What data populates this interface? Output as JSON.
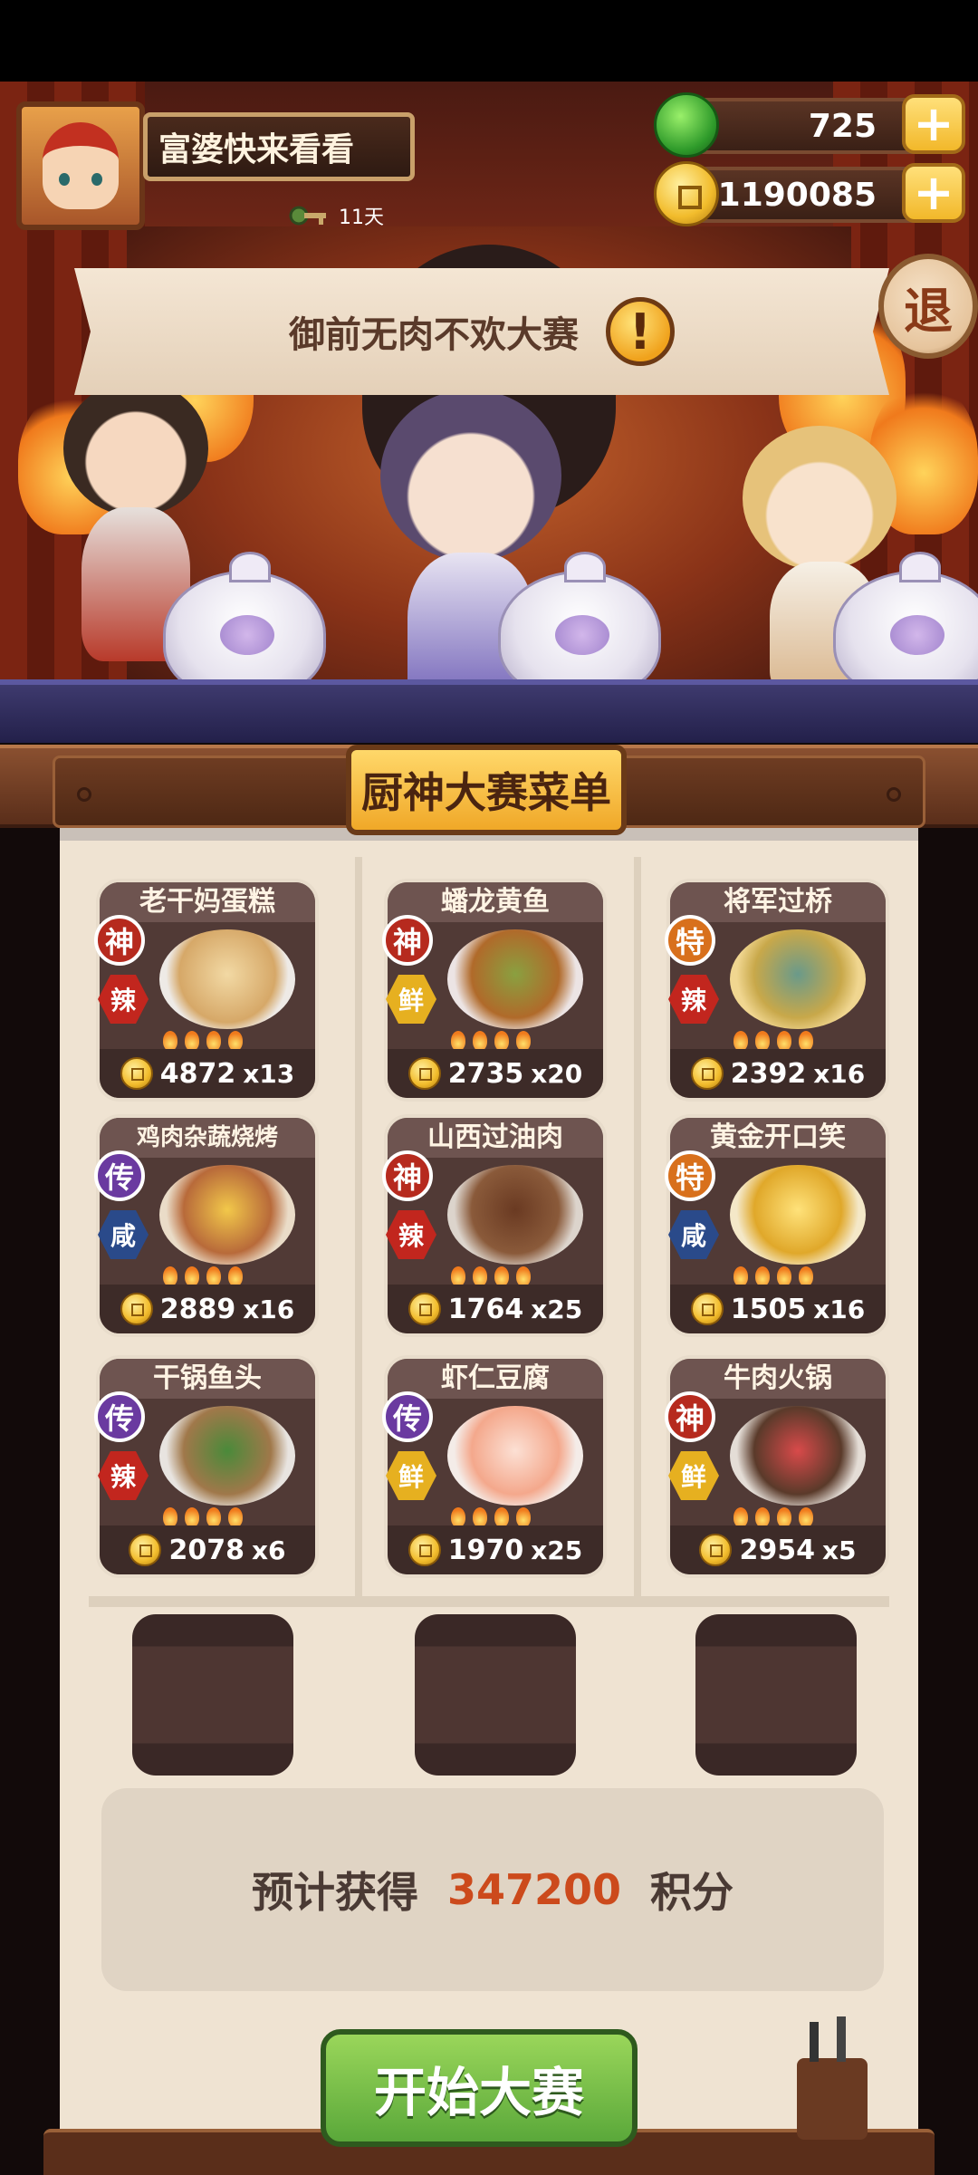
{
  "header": {
    "player_name": "富婆快来看看",
    "days_label": "11天",
    "gems": "725",
    "coins": "1190085",
    "plus_label": "+",
    "exit_label": "退"
  },
  "event": {
    "banner_title": "御前无肉不欢大赛",
    "alert_label": "!"
  },
  "menu": {
    "title": "厨神大赛菜单",
    "dishes": [
      {
        "name": "老干妈蛋糕",
        "rank": "神",
        "taste": "辣",
        "score": "4872",
        "mult": "x13"
      },
      {
        "name": "蟠龙黄鱼",
        "rank": "神",
        "taste": "鲜",
        "score": "2735",
        "mult": "x20"
      },
      {
        "name": "将军过桥",
        "rank": "特",
        "taste": "辣",
        "score": "2392",
        "mult": "x16"
      },
      {
        "name": "鸡肉杂蔬烧烤",
        "rank": "传",
        "taste": "咸",
        "score": "2889",
        "mult": "x16"
      },
      {
        "name": "山西过油肉",
        "rank": "神",
        "taste": "辣",
        "score": "1764",
        "mult": "x25"
      },
      {
        "name": "黄金开口笑",
        "rank": "特",
        "taste": "咸",
        "score": "1505",
        "mult": "x16"
      },
      {
        "name": "干锅鱼头",
        "rank": "传",
        "taste": "辣",
        "score": "2078",
        "mult": "x6"
      },
      {
        "name": "虾仁豆腐",
        "rank": "传",
        "taste": "鲜",
        "score": "1970",
        "mult": "x25"
      },
      {
        "name": "牛肉火锅",
        "rank": "神",
        "taste": "鲜",
        "score": "2954",
        "mult": "x5"
      }
    ]
  },
  "estimate": {
    "prefix": "预计获得",
    "value": "347200",
    "suffix": "积分"
  },
  "start_button": "开始大赛",
  "colors": {
    "rank_shen": "#b62a1e",
    "rank_te": "#d8701c",
    "rank_chuan": "#6a3aa0",
    "taste_la": "#c2261e",
    "taste_xian_fresh": "#e6b020",
    "taste_xian_salty": "#2a4a8a",
    "score_highlight": "#cc4a1c",
    "start_green": "#5aa83a"
  }
}
